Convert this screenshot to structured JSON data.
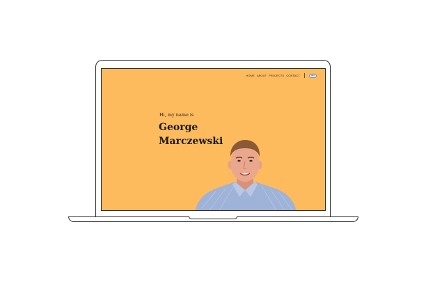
{
  "nav": {
    "items": [
      "HOME",
      "ABOUT",
      "PROJECTS",
      "CONTACT"
    ],
    "language_label": "EN"
  },
  "hero": {
    "greeting": "Hi, my name is",
    "first_name": "George",
    "last_name": "Marczewski"
  },
  "colors": {
    "background": "#fdbb5d",
    "text": "#1a1a1a",
    "shirt": "#9fb2d8",
    "skin": "#e9a88e"
  },
  "icons": {
    "language": "flag-toggle-icon",
    "portrait": "person-photo"
  }
}
